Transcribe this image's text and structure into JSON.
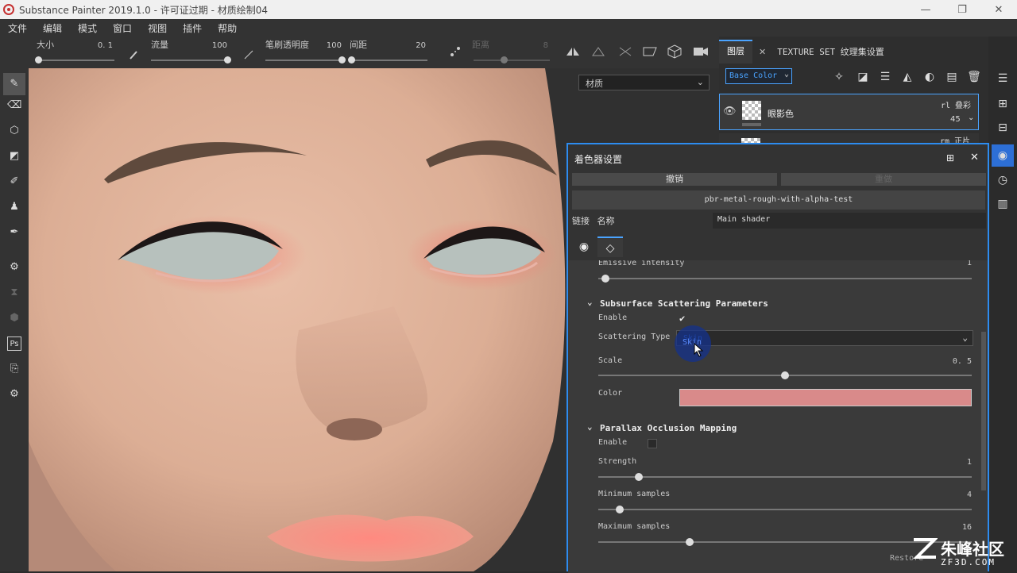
{
  "window": {
    "title": "Substance Painter 2019.1.0 - 许可证过期 - 材质绘制04",
    "minimize": "—",
    "restore": "❐",
    "close": "✕"
  },
  "menu": [
    "文件",
    "编辑",
    "模式",
    "窗口",
    "视图",
    "插件",
    "帮助"
  ],
  "tool_options": {
    "size_label": "大小",
    "size_value": "0. 1",
    "size_fraction": 0.0,
    "flow_label": "流量",
    "flow_value": "100",
    "flow_fraction": 1.0,
    "opacity_label": "笔刷透明度",
    "opacity_value": "100",
    "opacity_fraction": 1.0,
    "spacing_label": "间距",
    "spacing_value": "20",
    "spacing_fraction": 0.0,
    "distance_label": "距离",
    "distance_value": "8"
  },
  "viewport": {
    "material_select": "材质"
  },
  "layers": {
    "tab_layers": "图层",
    "tab_close": "✕",
    "tab_texture_set": "TEXTURE SET 纹理集设置",
    "channel": "Base Color",
    "layer_name": "眼影色",
    "blend_mode": "rl 叠彩",
    "opacity": "45",
    "layer2_blend": "rm 正片"
  },
  "shader_settings": {
    "title": "着色器设置",
    "undo": "撤销",
    "redo": "重做",
    "shader_file": "pbr-metal-rough-with-alpha-test",
    "link_label": "链接",
    "name_label": "名称",
    "name_value": "Main shader",
    "emissive_label": "Emissive intensity",
    "emissive_value": "1",
    "sss_section": "Subsurface Scattering Parameters",
    "sss_enable_label": "Enable",
    "sss_enabled": true,
    "scattering_type_label": "Scattering Type",
    "scattering_type_value": "Skin",
    "scale_label": "Scale",
    "scale_value": "0. 5",
    "scale_fraction": 0.5,
    "color_label": "Color",
    "color_value": "#d98a8a",
    "pom_section": "Parallax Occlusion Mapping",
    "pom_enable_label": "Enable",
    "pom_enabled": false,
    "strength_label": "Strength",
    "strength_value": "1",
    "min_samples_label": "Minimum samples",
    "min_samples_value": "4",
    "max_samples_label": "Maximum samples",
    "max_samples_value": "16",
    "restore_label": "Restore"
  },
  "watermark": {
    "brand": "朱峰社区",
    "url": "ZF3D.COM"
  },
  "colors": {
    "accent": "#2d8cf0",
    "panel": "#333333",
    "skin_color_swatch": "#d98a8a"
  }
}
